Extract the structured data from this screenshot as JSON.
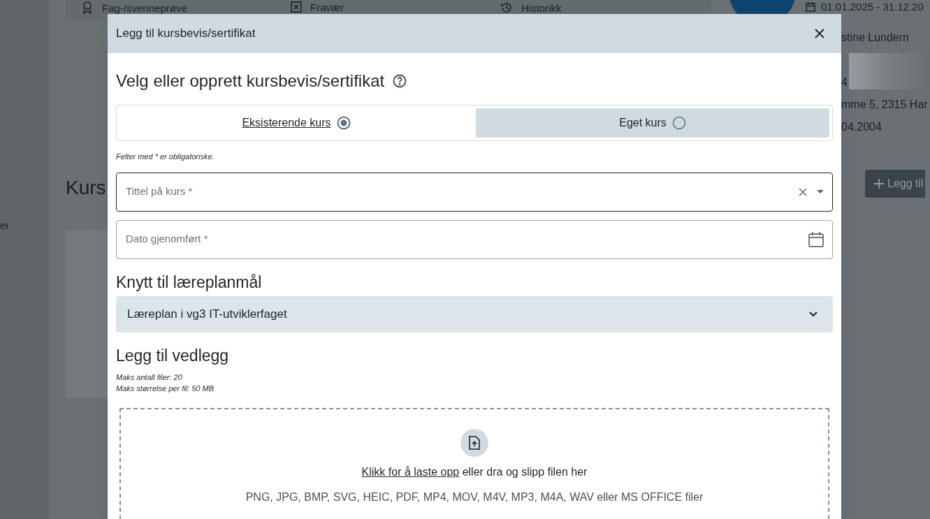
{
  "background": {
    "sidebar_text": "er",
    "tabs": [
      {
        "label": "Fag-/svenneprøve"
      },
      {
        "label": "Fravær"
      },
      {
        "label": "Historikk"
      }
    ],
    "info": {
      "period": "01.01.2025 - 31.12.20",
      "lines": [
        "stine Lundern",
        "4",
        "mme 5, 2315 Har",
        "04.2004"
      ]
    },
    "section_title": "Kurs",
    "add_button": "Legg til"
  },
  "modal": {
    "title": "Legg til kursbevis/sertifikat",
    "heading": "Velg eller opprett kursbevis/sertifikat",
    "options": [
      {
        "label": "Eksisterende kurs",
        "selected": true
      },
      {
        "label": "Eget kurs",
        "selected": false
      }
    ],
    "required_note": "Felter med * er obligatoriske.",
    "fields": [
      {
        "kind": "combobox",
        "placeholder": "Tittel på kurs *",
        "focused": true
      },
      {
        "kind": "date",
        "placeholder": "Dato gjenomført *",
        "focused": false
      }
    ],
    "curriculum_heading": "Knytt til læreplanmål",
    "curriculum": {
      "label": "Læreplan i vg3 IT-utviklerfaget",
      "expanded": false
    },
    "attachments_heading": "Legg til vedlegg",
    "limits": [
      "Maks antall filer: 20",
      "Maks størrelse per fil: 50 MB"
    ],
    "upload": {
      "link": "Klikk for å laste opp",
      "rest": "eller dra og slipp filen her",
      "formats": "PNG, JPG, BMP, SVG, HEIC, PDF, MP4, MOV, M4V, MP3, M4A, WAV eller MS OFFICE filer"
    }
  }
}
